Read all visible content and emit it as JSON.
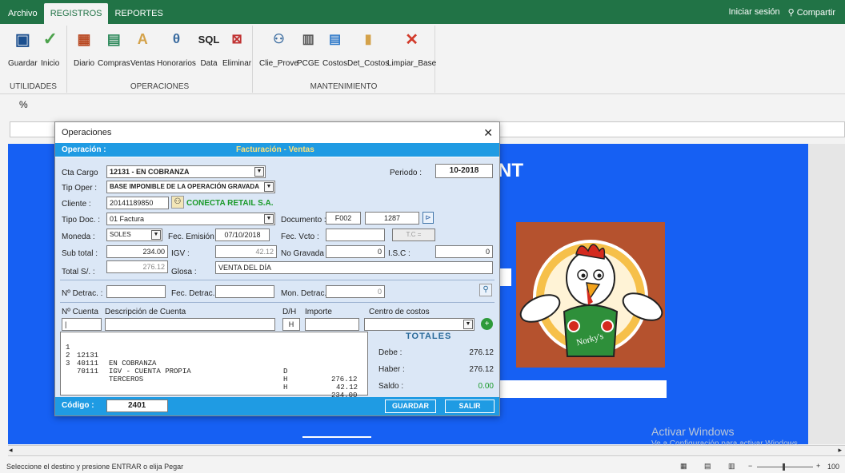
{
  "tabs": [
    "Archivo",
    "REGISTROS",
    "REPORTES"
  ],
  "active_tab": "REGISTROS",
  "account": {
    "signin": "Iniciar sesión",
    "share": "Compartir"
  },
  "ribbon": {
    "utilidades": {
      "label": "UTILIDADES",
      "buttons": [
        "Guardar",
        "Inicio"
      ]
    },
    "operaciones": {
      "label": "OPERACIONES",
      "buttons": [
        "Diario",
        "Compras",
        "Ventas",
        "Honorarios",
        "Data",
        "Eliminar"
      ],
      "sql": "SQL"
    },
    "mantenimiento": {
      "label": "MANTENIMIENTO",
      "buttons": [
        "Clie_Prove",
        "PCGE",
        "Costos",
        "Det_Costos",
        "Limpiar_Base"
      ]
    }
  },
  "percent_label": "%",
  "sheet": {
    "heading_fragment": "NT"
  },
  "watermark": {
    "title": "Activar Windows",
    "subtitle": "Ve a Configuración para activar Windows."
  },
  "status": {
    "message": "Seleccione el destino y presione ENTRAR o elija Pegar",
    "zoom": "100"
  },
  "dialog": {
    "title": "Operaciones",
    "close": "✕",
    "op_label": "Operación :",
    "op_value": "Facturación - Ventas",
    "cta_cargo": {
      "label": "Cta Cargo",
      "value": "12131 - EN COBRANZA"
    },
    "periodo": {
      "label": "Periodo :",
      "value": "10-2018"
    },
    "tip_oper": {
      "label": "Tip Oper :",
      "value": "BASE IMPONIBLE DE LA OPERACIÓN GRAVADA"
    },
    "cliente": {
      "label": "Cliente :",
      "ruc": "20141189850",
      "name": "CONECTA RETAIL S.A."
    },
    "tipo_doc": {
      "label": "Tipo Doc. :",
      "value": "01 Factura"
    },
    "documento": {
      "label": "Documento :",
      "serie": "F002",
      "numero": "1287"
    },
    "moneda": {
      "label": "Moneda :",
      "value": "SOLES"
    },
    "fec_emision": {
      "label": "Fec. Emisión :",
      "value": "07/10/2018"
    },
    "fec_vcto": {
      "label": "Fec. Vcto :",
      "value": ""
    },
    "tc": {
      "label": "T.C ="
    },
    "sub_total": {
      "label": "Sub total :",
      "value": "234.00"
    },
    "igv": {
      "label": "IGV :",
      "value": "42.12"
    },
    "no_gravada": {
      "label": "No Gravada :",
      "value": "0"
    },
    "isc": {
      "label": "I.S.C :",
      "value": "0"
    },
    "total": {
      "label": "Total S/. :",
      "value": "276.12"
    },
    "glosa": {
      "label": "Glosa :",
      "value": "VENTA DEL DÍA"
    },
    "detrac": {
      "label": "Nº Detrac. :",
      "fec_label": "Fec. Detrac. :",
      "mon_label": "Mon. Detrac. :",
      "mon_value": "0"
    },
    "cols": {
      "cuenta": "Nº Cuenta",
      "descripcion": "Descripción de Cuenta",
      "dh": "D/H",
      "importe": "Importe",
      "centro": "Centro de costos"
    },
    "entry": {
      "dh": "H"
    },
    "accounts": [
      {
        "n": "1",
        "cuenta": "12131",
        "desc": "EN COBRANZA",
        "dh": "D",
        "importe": "276.12"
      },
      {
        "n": "2",
        "cuenta": "40111",
        "desc": "IGV - CUENTA PROPIA",
        "dh": "H",
        "importe": "42.12"
      },
      {
        "n": "3",
        "cuenta": "70111",
        "desc": "TERCEROS",
        "dh": "H",
        "importe": "234.00"
      }
    ],
    "totales": {
      "title": "TOTALES",
      "debe_label": "Debe :",
      "debe": "276.12",
      "haber_label": "Haber :",
      "haber": "276.12",
      "saldo_label": "Saldo :",
      "saldo": "0.00"
    },
    "codigo": {
      "label": "Código :",
      "value": "2401"
    },
    "btn_guardar": "GUARDAR",
    "btn_salir": "SALIR"
  },
  "colors": {
    "excel_green": "#217346",
    "sheet_blue": "#1660f3",
    "dialog_strip": "#1f9be3",
    "total_green": "#1a9a2a"
  }
}
